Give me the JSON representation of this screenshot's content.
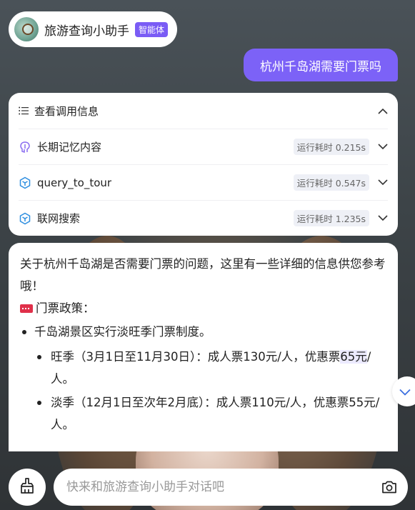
{
  "header": {
    "agent_name": "旅游查询小助手",
    "badge": "智能体",
    "avatar_icon": "agent-avatar-icon"
  },
  "user_message": "杭州千岛湖需要门票吗",
  "call_info": {
    "title": "查看调用信息",
    "items": [
      {
        "label": "长期记忆内容",
        "time": "运行耗时 0.215s",
        "icon": "memory-icon"
      },
      {
        "label": "query_to_tour",
        "time": "运行耗时 0.547s",
        "icon": "plugin-icon"
      },
      {
        "label": "联网搜索",
        "time": "运行耗时 1.235s",
        "icon": "plugin-icon"
      }
    ]
  },
  "answer": {
    "intro": "关于杭州千岛湖是否需要门票的问题，这里有一些详细的信息供您参考哦！",
    "policy_heading": "门票政策：",
    "policy_emoji": "ticket-emoji",
    "bullet": "千岛湖景区实行淡旺季门票制度。",
    "sub_bullets": {
      "peak_prefix": "旺季（3月1日至11月30日）：成人票130元/人，优惠票",
      "peak_highlight_1": "65",
      "peak_highlight_2": "元",
      "peak_suffix": "/人。",
      "off_peak": "淡季（12月1日至次年2月底）：成人票110元/人，优惠票55元/人。"
    }
  },
  "input": {
    "placeholder": "快来和旅游查询小助手对话吧",
    "value": ""
  },
  "colors": {
    "accent": "#7c62f7",
    "badge": "#7a5cf5",
    "highlight": "#eceaff"
  }
}
